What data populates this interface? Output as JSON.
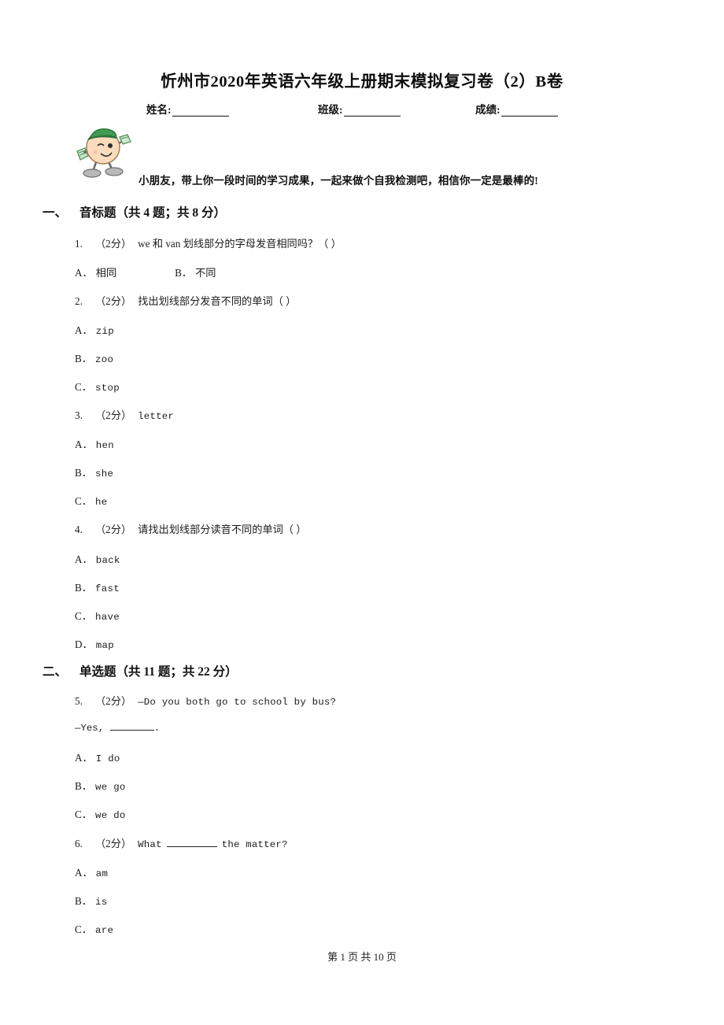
{
  "header": {
    "title": "忻州市2020年英语六年级上册期末模拟复习卷（2）B卷",
    "fields": [
      {
        "label": "姓名:"
      },
      {
        "label": "班级:"
      },
      {
        "label": "成绩:"
      }
    ],
    "greeting": "小朋友，带上你一段时间的学习成果，一起来做个自我检测吧，相信你一定是最棒的!",
    "mascot_icon": "cartoon-student-mascot-icon"
  },
  "sections": [
    {
      "number": "一、",
      "title": "音标题（共 4 题；共 8 分）"
    },
    {
      "number": "二、",
      "title": "单选题（共 11 题；共 22 分）"
    }
  ],
  "questions": [
    {
      "num": "1.",
      "score": "（2分）",
      "stem": "we 和 van 划线部分的字母发音相同吗？（      ）",
      "options": [
        {
          "letter": "A．",
          "text": "相同"
        },
        {
          "letter": "B．",
          "text": "不同"
        }
      ]
    },
    {
      "num": "2.",
      "score": "（2分）",
      "stem": "找出划线部分发音不同的单词（      ）",
      "options": [
        {
          "letter": "A．",
          "text": "zip"
        },
        {
          "letter": "B．",
          "text": "zoo"
        },
        {
          "letter": "C．",
          "text": "stop"
        }
      ]
    },
    {
      "num": "3.",
      "score": "（2分）",
      "stem": "letter",
      "options": [
        {
          "letter": "A．",
          "text": "hen"
        },
        {
          "letter": "B．",
          "text": "she"
        },
        {
          "letter": "C．",
          "text": "he"
        }
      ]
    },
    {
      "num": "4.",
      "score": "（2分）",
      "stem": "请找出划线部分读音不同的单词（      ）",
      "options": [
        {
          "letter": "A．",
          "text": "back"
        },
        {
          "letter": "B．",
          "text": "fast"
        },
        {
          "letter": "C．",
          "text": "have"
        },
        {
          "letter": "D．",
          "text": "map"
        }
      ]
    },
    {
      "num": "5.",
      "score": "（2分）",
      "stem": "—Do you both go to school by bus?",
      "stem_line2_prefix": "—Yes,",
      "stem_line2_suffix": ".",
      "options": [
        {
          "letter": "A．",
          "text": "I do"
        },
        {
          "letter": "B．",
          "text": "we go"
        },
        {
          "letter": "C．",
          "text": "we do"
        }
      ]
    },
    {
      "num": "6.",
      "score": "（2分）",
      "stem_prefix": "What",
      "stem_suffix": "the matter?",
      "options": [
        {
          "letter": "A．",
          "text": "am"
        },
        {
          "letter": "B．",
          "text": "is"
        },
        {
          "letter": "C．",
          "text": "are"
        }
      ]
    }
  ],
  "footer": {
    "text": "第 1 页 共 10 页"
  }
}
